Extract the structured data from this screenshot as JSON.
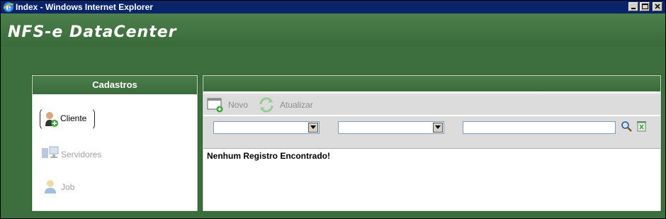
{
  "window": {
    "title": "Index - Windows Internet Explorer"
  },
  "app": {
    "logo": "NFS-e DataCenter"
  },
  "sidebar": {
    "title": "Cadastros",
    "items": [
      {
        "label": "Cliente",
        "icon": "client-add-icon",
        "enabled": true
      },
      {
        "label": "Servidores",
        "icon": "servers-icon",
        "enabled": false
      },
      {
        "label": "Job",
        "icon": "user-job-icon",
        "enabled": false
      }
    ]
  },
  "toolbar": {
    "novo_label": "Novo",
    "atualizar_label": "Atualizar"
  },
  "filters": {
    "select1_value": "",
    "select2_value": "",
    "search_value": ""
  },
  "content": {
    "message": "Nenhum Registro Encontrado!"
  },
  "colors": {
    "header_green": "#3c6b3c",
    "titlebar_blue": "#0a246a",
    "disabled_text": "#a0a0a0"
  }
}
